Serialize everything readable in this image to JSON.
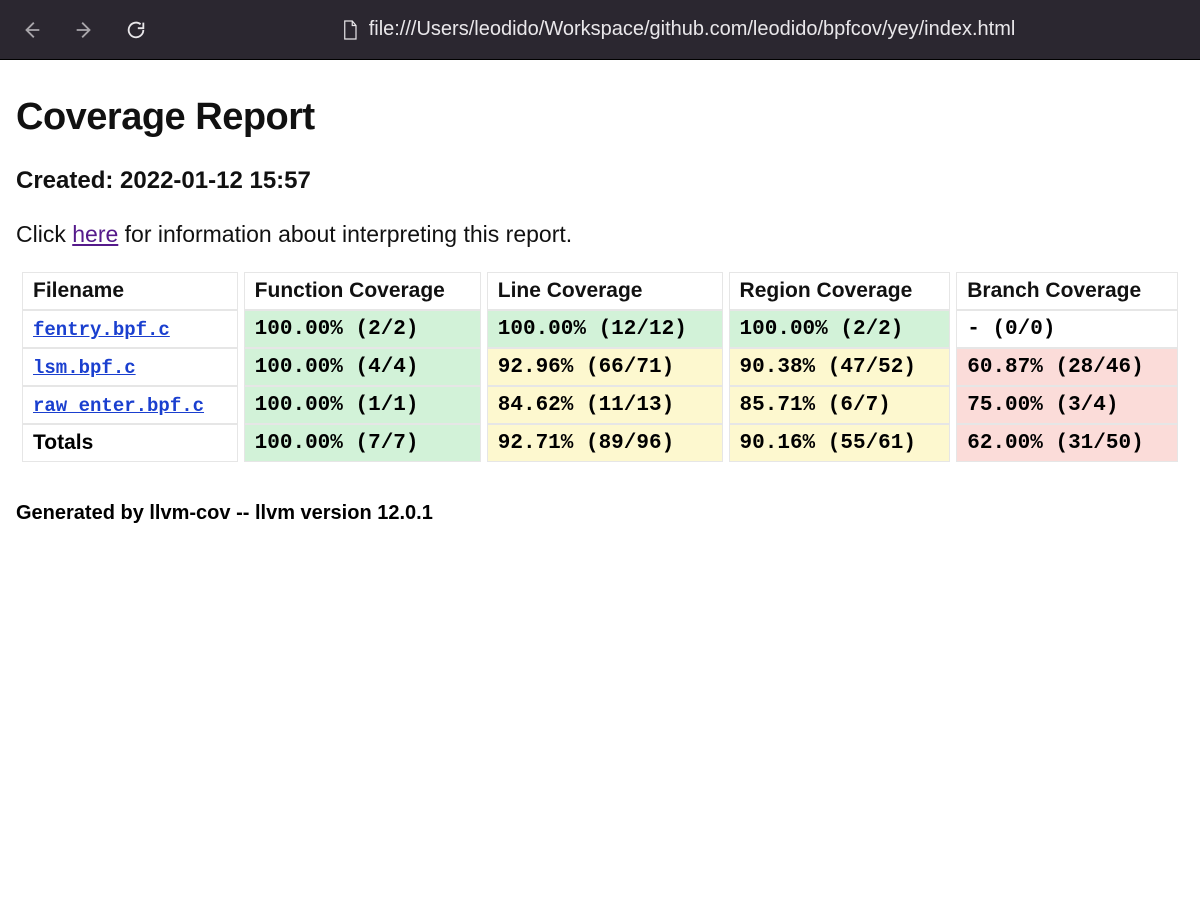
{
  "browser": {
    "url": "file:///Users/leodido/Workspace/github.com/leodido/bpfcov/yey/index.html"
  },
  "page": {
    "title": "Coverage Report",
    "created_prefix": "Created: ",
    "created_value": "2022-01-12 15:57",
    "hint_before": "Click ",
    "hint_link": "here",
    "hint_after": " for information about interpreting this report.",
    "footer": "Generated by llvm-cov -- llvm version 12.0.1"
  },
  "table": {
    "headers": {
      "filename": "Filename",
      "function": "Function Coverage",
      "line": "Line Coverage",
      "region": "Region Coverage",
      "branch": "Branch Coverage"
    },
    "rows": [
      {
        "filename": "fentry.bpf.c",
        "is_link": true,
        "function": {
          "text": "100.00% (2/2)",
          "color": "green"
        },
        "line": {
          "text": "100.00% (12/12)",
          "color": "green"
        },
        "region": {
          "text": "100.00% (2/2)",
          "color": "green"
        },
        "branch": {
          "text": "- (0/0)",
          "color": "plain"
        }
      },
      {
        "filename": "lsm.bpf.c",
        "is_link": true,
        "function": {
          "text": "100.00% (4/4)",
          "color": "green"
        },
        "line": {
          "text": "92.96% (66/71)",
          "color": "yellow"
        },
        "region": {
          "text": "90.38% (47/52)",
          "color": "yellow"
        },
        "branch": {
          "text": "60.87% (28/46)",
          "color": "red"
        }
      },
      {
        "filename": "raw_enter.bpf.c",
        "is_link": true,
        "function": {
          "text": "100.00% (1/1)",
          "color": "green"
        },
        "line": {
          "text": "84.62% (11/13)",
          "color": "yellow"
        },
        "region": {
          "text": "85.71% (6/7)",
          "color": "yellow"
        },
        "branch": {
          "text": "75.00% (3/4)",
          "color": "red"
        }
      },
      {
        "filename": "Totals",
        "is_link": false,
        "function": {
          "text": "100.00% (7/7)",
          "color": "green"
        },
        "line": {
          "text": "92.71% (89/96)",
          "color": "yellow"
        },
        "region": {
          "text": "90.16% (55/61)",
          "color": "yellow"
        },
        "branch": {
          "text": "62.00% (31/50)",
          "color": "red"
        }
      }
    ]
  }
}
